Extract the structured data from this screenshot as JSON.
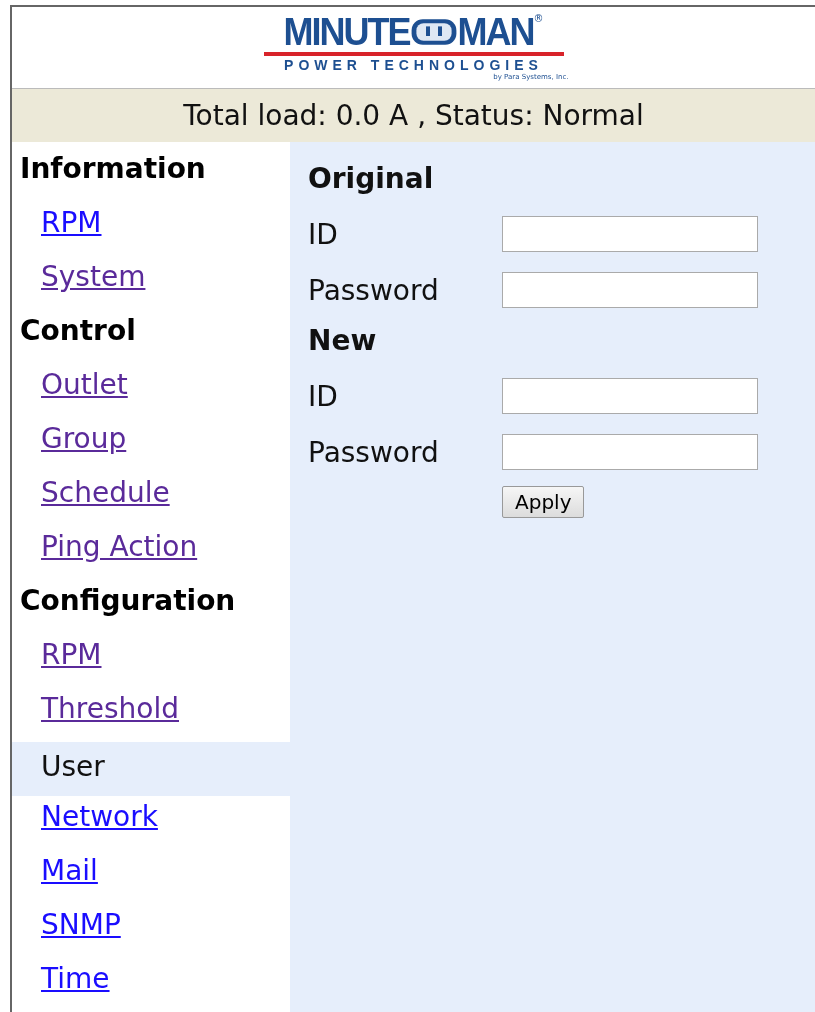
{
  "logo": {
    "brand_left": "MINUTE",
    "brand_right": "MAN",
    "registered": "®",
    "tagline": "POWER TECHNOLOGIES",
    "byline": "by Para Systems, Inc."
  },
  "status_bar": "Total load: 0.0 A , Status: Normal",
  "sidebar": {
    "sections": [
      {
        "title": "Information",
        "items": [
          {
            "label": "RPM",
            "visited": false,
            "selected": false
          },
          {
            "label": "System",
            "visited": true,
            "selected": false
          }
        ]
      },
      {
        "title": "Control",
        "items": [
          {
            "label": "Outlet",
            "visited": true,
            "selected": false
          },
          {
            "label": "Group",
            "visited": true,
            "selected": false
          },
          {
            "label": "Schedule",
            "visited": true,
            "selected": false
          },
          {
            "label": "Ping Action",
            "visited": true,
            "selected": false
          }
        ]
      },
      {
        "title": "Configuration",
        "items": [
          {
            "label": "RPM",
            "visited": true,
            "selected": false
          },
          {
            "label": "Threshold",
            "visited": true,
            "selected": false
          },
          {
            "label": "User",
            "selected": true
          },
          {
            "label": "Network",
            "visited": false,
            "selected": false
          },
          {
            "label": "Mail",
            "visited": false,
            "selected": false
          },
          {
            "label": "SNMP",
            "visited": false,
            "selected": false
          },
          {
            "label": "Time",
            "visited": false,
            "selected": false
          }
        ]
      }
    ]
  },
  "form": {
    "groups": [
      {
        "title": "Original",
        "fields": [
          {
            "label": "ID"
          },
          {
            "label": "Password"
          }
        ]
      },
      {
        "title": "New",
        "fields": [
          {
            "label": "ID"
          },
          {
            "label": "Password"
          }
        ]
      }
    ],
    "button": "Apply"
  }
}
